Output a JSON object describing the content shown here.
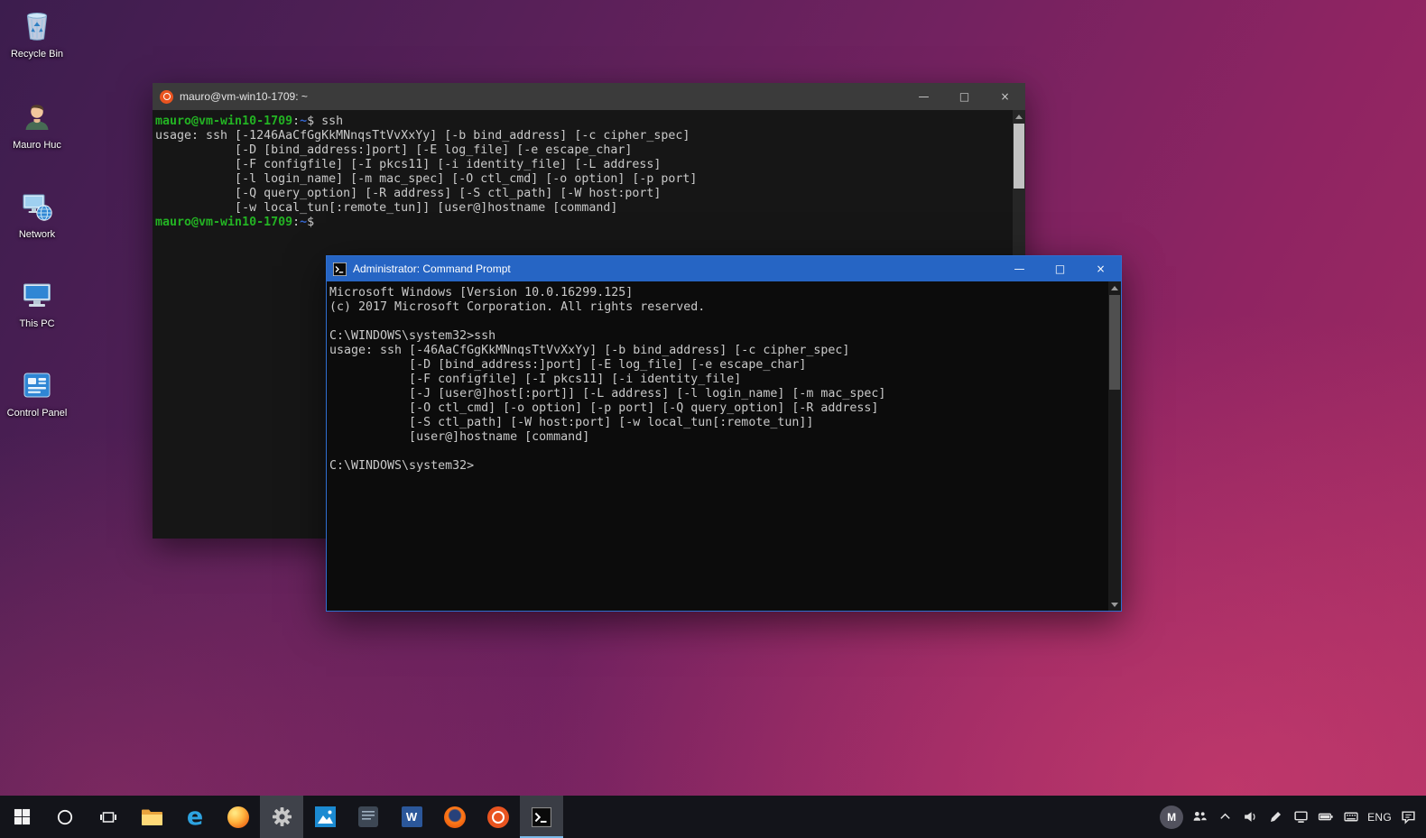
{
  "desktop": {
    "icons": [
      {
        "label": "Recycle Bin"
      },
      {
        "label": "Mauro Huc"
      },
      {
        "label": "Network"
      },
      {
        "label": "This PC"
      },
      {
        "label": "Control Panel"
      }
    ]
  },
  "ubuntu_window": {
    "title": "mauro@vm-win10-1709: ~",
    "lines": [
      {
        "segments": [
          {
            "text": "mauro@vm-win10-1709",
            "color": "green"
          },
          {
            "text": ":",
            "color": "fg"
          },
          {
            "text": "~",
            "color": "blue"
          },
          {
            "text": "$ ssh",
            "color": "fg"
          }
        ]
      },
      {
        "text": "usage: ssh [-1246AaCfGgKkMNnqsTtVvXxYy] [-b bind_address] [-c cipher_spec]"
      },
      {
        "text": "           [-D [bind_address:]port] [-E log_file] [-e escape_char]"
      },
      {
        "text": "           [-F configfile] [-I pkcs11] [-i identity_file] [-L address]"
      },
      {
        "text": "           [-l login_name] [-m mac_spec] [-O ctl_cmd] [-o option] [-p port]"
      },
      {
        "text": "           [-Q query_option] [-R address] [-S ctl_path] [-W host:port]"
      },
      {
        "text": "           [-w local_tun[:remote_tun]] [user@]hostname [command]"
      },
      {
        "segments": [
          {
            "text": "mauro@vm-win10-1709",
            "color": "green"
          },
          {
            "text": ":",
            "color": "fg"
          },
          {
            "text": "~",
            "color": "blue"
          },
          {
            "text": "$ ",
            "color": "fg"
          }
        ]
      }
    ]
  },
  "cmd_window": {
    "title": "Administrator: Command Prompt",
    "lines": [
      {
        "text": "Microsoft Windows [Version 10.0.16299.125]"
      },
      {
        "text": "(c) 2017 Microsoft Corporation. All rights reserved."
      },
      {
        "text": ""
      },
      {
        "text": "C:\\WINDOWS\\system32>ssh"
      },
      {
        "text": "usage: ssh [-46AaCfGgKkMNnqsTtVvXxYy] [-b bind_address] [-c cipher_spec]"
      },
      {
        "text": "           [-D [bind_address:]port] [-E log_file] [-e escape_char]"
      },
      {
        "text": "           [-F configfile] [-I pkcs11] [-i identity_file]"
      },
      {
        "text": "           [-J [user@]host[:port]] [-L address] [-l login_name] [-m mac_spec]"
      },
      {
        "text": "           [-O ctl_cmd] [-o option] [-p port] [-Q query_option] [-R address]"
      },
      {
        "text": "           [-S ctl_path] [-W host:port] [-w local_tun[:remote_tun]]"
      },
      {
        "text": "           [user@]hostname [command]"
      },
      {
        "text": ""
      },
      {
        "text": "C:\\WINDOWS\\system32>"
      }
    ]
  },
  "window_controls": {
    "minimize": "—",
    "maximize": "□",
    "close": "×"
  },
  "taskbar": {
    "app_icons": [
      "windows-start",
      "cortana-search",
      "task-view",
      "file-explorer",
      "edge",
      "firefox",
      "settings",
      "photos",
      "notebook",
      "word",
      "firefox-nightly",
      "ubuntu",
      "command-prompt"
    ],
    "edge_glyph": "e",
    "word_glyph": "W",
    "tray": {
      "avatar_letter": "M",
      "language": "ENG"
    }
  },
  "colors": {
    "cmd_titlebar_blue": "#2665c4",
    "prompt_green": "#23b323",
    "prompt_blue": "#3465cf",
    "ubuntu_orange": "#e95420",
    "taskbar_black": "#13141a"
  }
}
